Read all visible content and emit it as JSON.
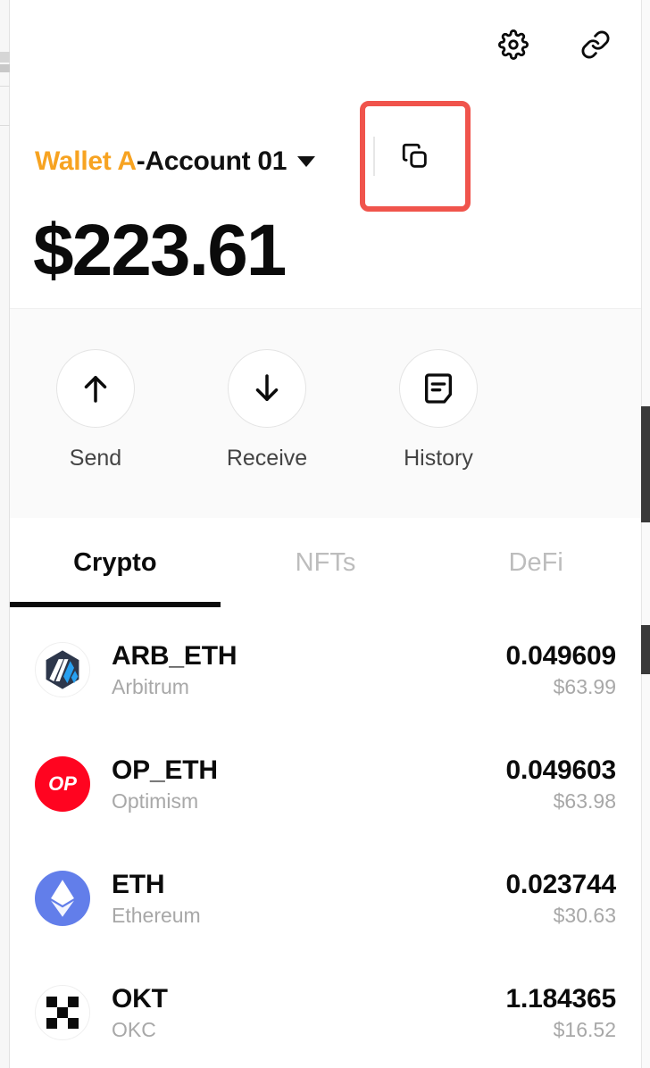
{
  "topbar": {
    "settings_icon": "gear-icon",
    "link_icon": "link-icon"
  },
  "wallet": {
    "name": "Wallet A",
    "separator": " - ",
    "account": "Account 01",
    "caret_icon": "chevron-down-icon",
    "copy_icon": "copy-icon",
    "highlight_color": "#F0544C",
    "name_color": "#F7A321"
  },
  "balance": {
    "total": "$223.61"
  },
  "actions": [
    {
      "label": "Send",
      "icon": "arrow-up-icon"
    },
    {
      "label": "Receive",
      "icon": "arrow-down-icon"
    },
    {
      "label": "History",
      "icon": "document-icon"
    }
  ],
  "tabs": [
    {
      "label": "Crypto",
      "active": true
    },
    {
      "label": "NFTs",
      "active": false
    },
    {
      "label": "DeFi",
      "active": false
    }
  ],
  "tokens": [
    {
      "symbol": "ARB_ETH",
      "network": "Arbitrum",
      "amount": "0.049609",
      "fiat": "$63.99",
      "icon": "arbitrum-icon"
    },
    {
      "symbol": "OP_ETH",
      "network": "Optimism",
      "amount": "0.049603",
      "fiat": "$63.98",
      "icon": "optimism-icon",
      "icon_label": "OP",
      "icon_color": "#FF0420"
    },
    {
      "symbol": "ETH",
      "network": "Ethereum",
      "amount": "0.023744",
      "fiat": "$30.63",
      "icon": "ethereum-icon",
      "icon_color": "#627EEA"
    },
    {
      "symbol": "OKT",
      "network": "OKC",
      "amount": "1.184365",
      "fiat": "$16.52",
      "icon": "okc-icon"
    }
  ]
}
